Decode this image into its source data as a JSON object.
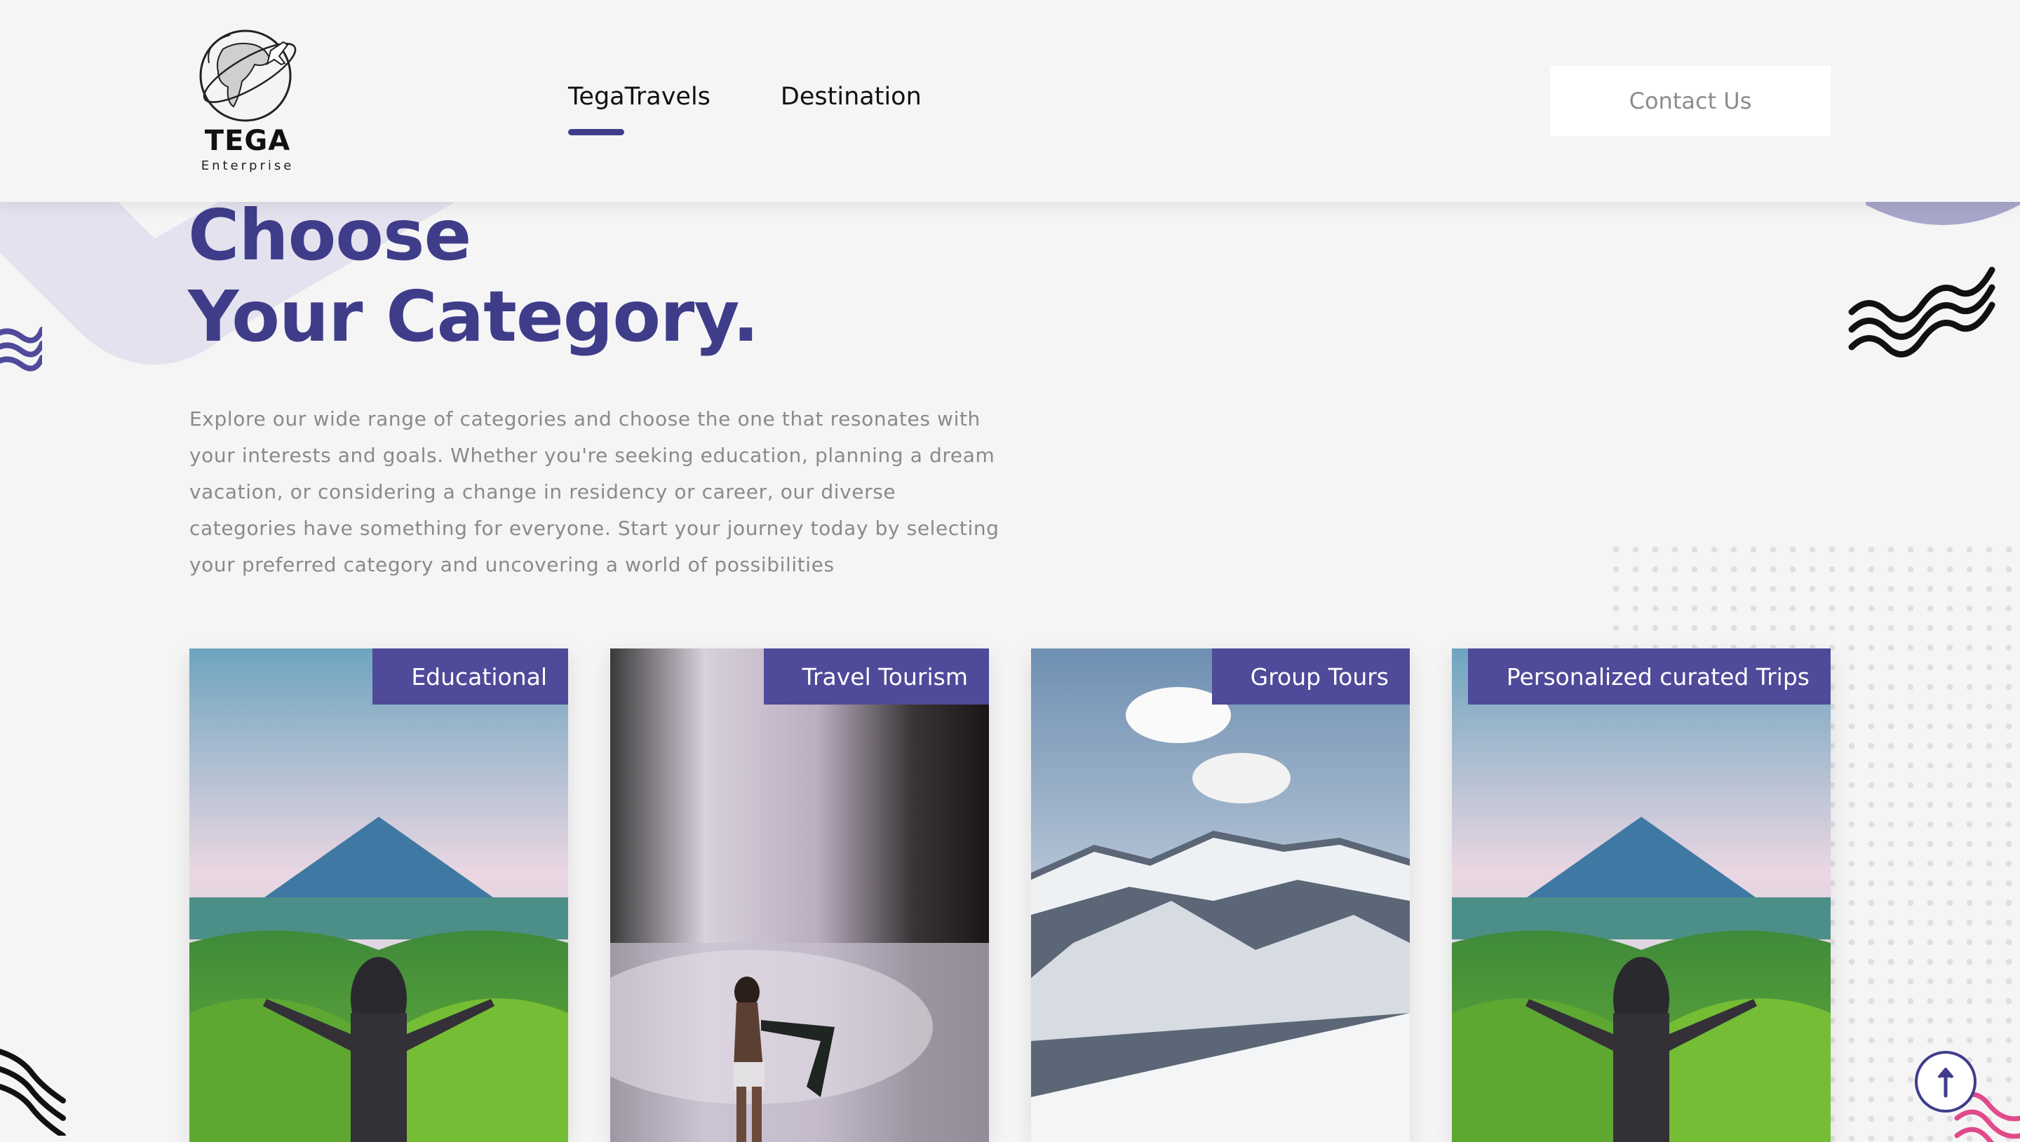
{
  "header": {
    "logo": {
      "name": "TEGA",
      "subtitle": "Enterprise"
    },
    "nav": [
      {
        "label": "TegaTravels",
        "active": true
      },
      {
        "label": "Destination",
        "active": false
      }
    ],
    "contact_label": "Contact Us"
  },
  "hero": {
    "title_line1": "Choose",
    "title_line2": "Your Category.",
    "description": "Explore our wide range of categories and choose the one that resonates with your interests and goals. Whether you're seeking education, planning a dream vacation, or considering a change in residency or career, our diverse categories have something for everyone. Start your journey today by selecting your preferred category and uncovering a world of possibilities"
  },
  "categories": [
    {
      "label": "Educational",
      "image": "mountain-hiker-photo"
    },
    {
      "label": "Travel Tourism",
      "image": "waterfall-woman-photo"
    },
    {
      "label": "Group Tours",
      "image": "snowy-mountains-photo"
    },
    {
      "label": "Personalized curated Trips",
      "image": "mountain-hiker-photo"
    }
  ],
  "icons": {
    "scroll_top": "arrow-up-icon",
    "logo": "globe-plane-icon"
  },
  "colors": {
    "accent": "#3f3d8a",
    "label_bg": "#4f4a99",
    "background": "#f5f5f5",
    "text_muted": "#8a8a8a"
  }
}
